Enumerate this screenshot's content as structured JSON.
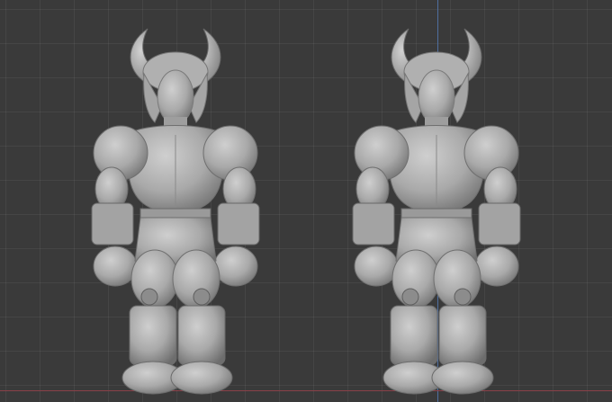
{
  "viewport": {
    "mode": "3D viewport",
    "background_color": "#3a3a3a",
    "grid_color": "#444444",
    "axis_y_color": "#4f6fa0",
    "axis_x_color": "#8a4048",
    "model_color": "#a7a7a7"
  },
  "models": [
    {
      "name": "horned-muscular-figure-left",
      "variant": "broader"
    },
    {
      "name": "horned-muscular-figure-right",
      "variant": "slimmer"
    }
  ]
}
